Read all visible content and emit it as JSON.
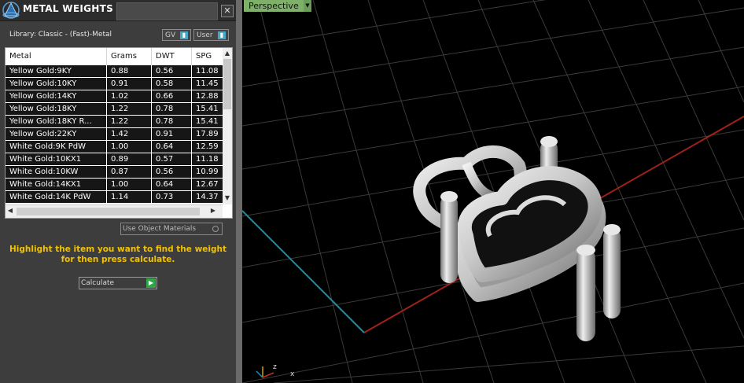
{
  "panel": {
    "title": "METAL WEIGHTS",
    "close_label": "✕",
    "library_label": "Library: Classic - (Fast)-Metal",
    "gv_label": "GV",
    "user_label": "User",
    "table": {
      "headers": [
        "Metal",
        "Grams",
        "DWT",
        "SPG"
      ],
      "rows": [
        [
          "Yellow Gold:9KY",
          "0.88",
          "0.56",
          "11.08"
        ],
        [
          "Yellow Gold:10KY",
          "0.91",
          "0.58",
          "11.45"
        ],
        [
          "Yellow Gold:14KY",
          "1.02",
          "0.66",
          "12.88"
        ],
        [
          "Yellow Gold:18KY",
          "1.22",
          "0.78",
          "15.41"
        ],
        [
          "Yellow Gold:18KY R...",
          "1.22",
          "0.78",
          "15.41"
        ],
        [
          "Yellow Gold:22KY",
          "1.42",
          "0.91",
          "17.89"
        ],
        [
          "White Gold:9K PdW",
          "1.00",
          "0.64",
          "12.59"
        ],
        [
          "White Gold:10KX1",
          "0.89",
          "0.57",
          "11.18"
        ],
        [
          "White Gold:10KW",
          "0.87",
          "0.56",
          "10.99"
        ],
        [
          "White Gold:14KX1",
          "1.00",
          "0.64",
          "12.67"
        ],
        [
          "White Gold:14K PdW",
          "1.14",
          "0.73",
          "14.37"
        ]
      ]
    },
    "use_object_materials": "Use Object Materials",
    "hint_line1": "Highlight the item you want to find the weight",
    "hint_line2": "for then press calculate.",
    "calculate_label": "Calculate"
  },
  "viewport": {
    "view_name": "Perspective",
    "axis_z": "z",
    "axis_x": "x"
  },
  "colors": {
    "hint_text": "#f2c200",
    "view_tab": "#7fb06a",
    "x_axis": "#a0201a",
    "y_axis": "#1f8fa0",
    "grid": "#3a3a3a"
  }
}
